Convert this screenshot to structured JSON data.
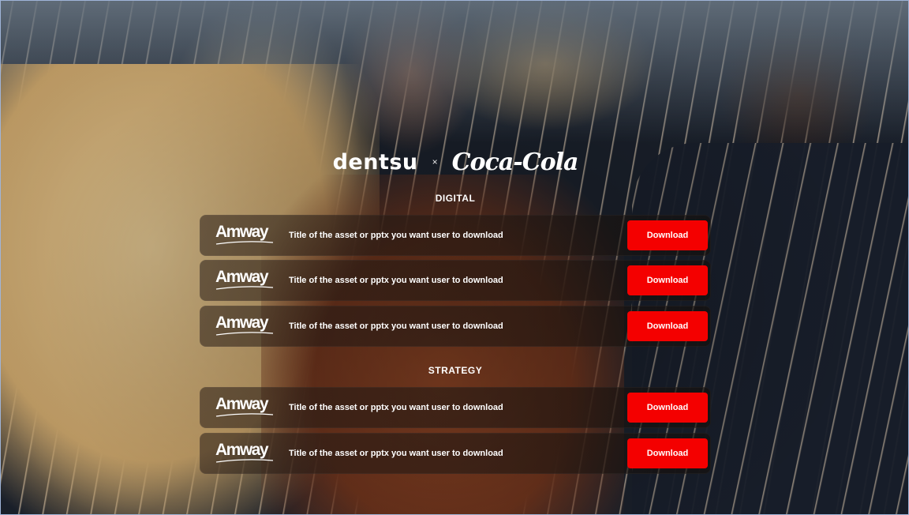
{
  "brand": {
    "left_logo": "dentsu",
    "separator": "×",
    "right_logo": "Coca-Cola"
  },
  "sections": [
    {
      "title": "DIGITAL",
      "items": [
        {
          "logo": "Amway",
          "title": "Title of the asset or pptx you want user to download",
          "button": "Download"
        },
        {
          "logo": "Amway",
          "title": "Title of the asset or pptx you want user to download",
          "button": "Download"
        },
        {
          "logo": "Amway",
          "title": "Title of the asset or pptx you want user to download",
          "button": "Download"
        }
      ]
    },
    {
      "title": "STRATEGY",
      "items": [
        {
          "logo": "Amway",
          "title": "Title of the asset or pptx you want user to download",
          "button": "Download"
        },
        {
          "logo": "Amway",
          "title": "Title of the asset or pptx you want user to download",
          "button": "Download"
        }
      ]
    }
  ],
  "colors": {
    "button": "#f40000",
    "text": "#ffffff"
  }
}
